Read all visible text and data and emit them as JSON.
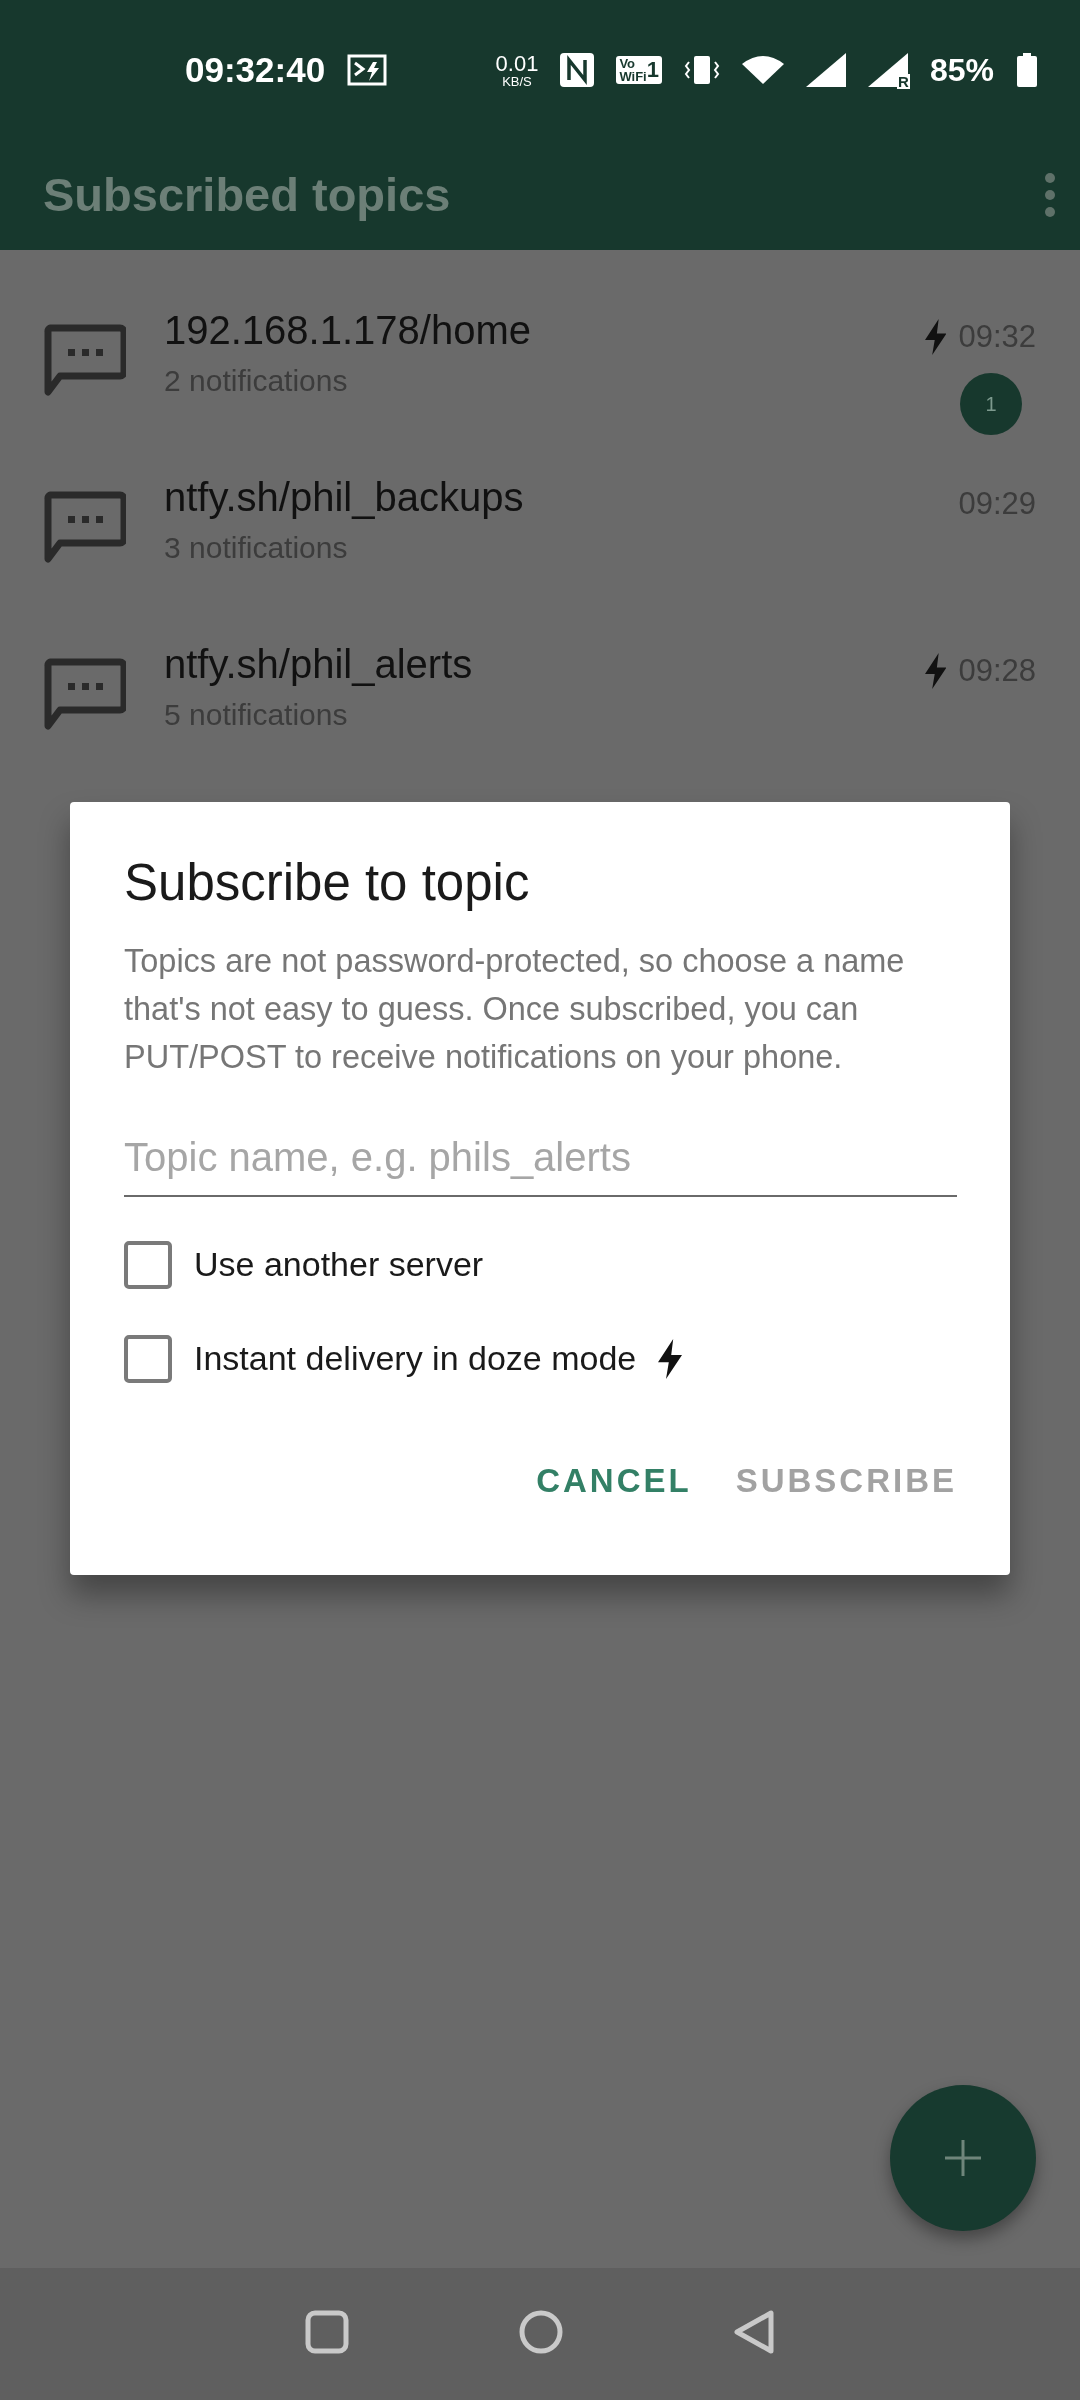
{
  "status_bar": {
    "time": "09:32:40",
    "speed": "0.01",
    "speed_unit": "KB/S",
    "vowifi": {
      "top": "Vo",
      "bottom": "WiFi",
      "sim": "1"
    },
    "roaming": "R",
    "battery": "85%"
  },
  "app_bar": {
    "title": "Subscribed topics"
  },
  "topics": [
    {
      "name": "192.168.1.178/home",
      "count": "2 notifications",
      "time": "09:32",
      "instant": true,
      "unread": "1"
    },
    {
      "name": "ntfy.sh/phil_backups",
      "count": "3 notifications",
      "time": "09:29",
      "instant": false
    },
    {
      "name": "ntfy.sh/phil_alerts",
      "count": "5 notifications",
      "time": "09:28",
      "instant": true
    }
  ],
  "dialog": {
    "title": "Subscribe to topic",
    "text": "Topics are not password-protected, so choose a name that's not easy to guess. Once subscribed, you can PUT/POST to receive notifications on your phone.",
    "topic_field": {
      "placeholder": "Topic name, e.g. phils_alerts"
    },
    "options": [
      {
        "label": "Use another server",
        "checked": false,
        "instant_icon": false
      },
      {
        "label": "Instant delivery in doze mode",
        "checked": false,
        "instant_icon": true
      }
    ],
    "buttons": [
      {
        "label": "CANCEL",
        "disabled": false
      },
      {
        "label": "SUBSCRIBE",
        "disabled": true
      }
    ]
  }
}
